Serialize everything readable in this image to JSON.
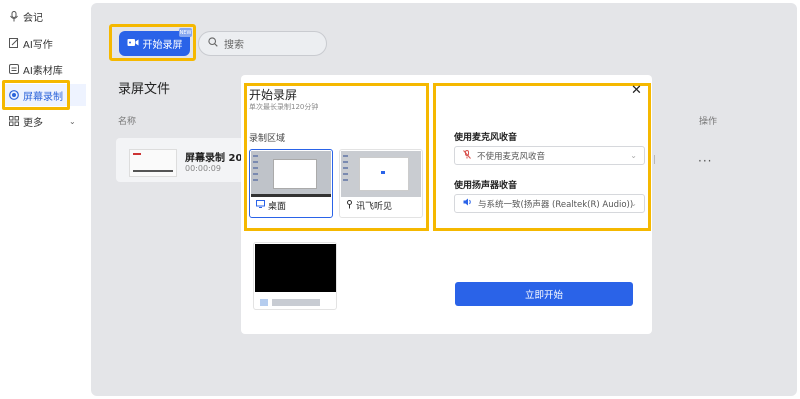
{
  "sidebar": {
    "items": [
      {
        "label": "会记",
        "icon": "microphone-icon"
      },
      {
        "label": "AI写作",
        "icon": "edit-icon"
      },
      {
        "label": "AI素材库",
        "icon": "library-icon"
      },
      {
        "label": "屏幕录制",
        "icon": "record-icon"
      },
      {
        "label": "更多",
        "icon": "grid-icon"
      }
    ]
  },
  "toolbar": {
    "start_label": "开始录屏",
    "badge": "NEW",
    "search_placeholder": "搜索"
  },
  "list": {
    "title": "录屏文件",
    "col_name": "名称",
    "col_op": "操作",
    "row": {
      "name": "屏幕录制 2025",
      "duration": "00:00:09",
      "more": "···"
    }
  },
  "dialog": {
    "title": "开始录屏",
    "subtitle": "单次最长录制120分钟",
    "area_label": "录制区域",
    "sources": [
      {
        "label": "桌面",
        "icon": "monitor-icon"
      },
      {
        "label": "讯飞听见",
        "icon": "app-icon"
      }
    ],
    "mic_label": "使用麦克风收音",
    "mic_value": "不使用麦克风收音",
    "speaker_label": "使用扬声器收音",
    "speaker_value": "与系统一致(扬声器 (Realtek(R) Audio))",
    "start_button": "立即开始",
    "close": "✕"
  },
  "colors": {
    "accent": "#2a63e8",
    "highlight": "#f5b800",
    "panel": "#e4e5e8"
  }
}
